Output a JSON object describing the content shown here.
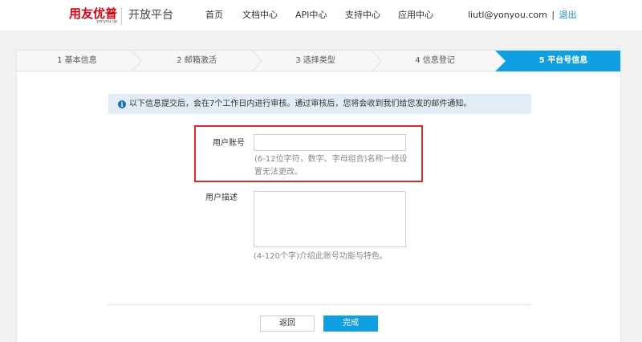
{
  "header": {
    "logo_text": "用友优普",
    "logo_sub": "yonyou up",
    "platform_title": "开放平台",
    "nav": [
      "首页",
      "文档中心",
      "API中心",
      "支持中心",
      "应用中心"
    ],
    "user_email": "liutl@yonyou.com",
    "separator": "|",
    "logout": "退出"
  },
  "steps": [
    "1 基本信息",
    "2 邮箱激活",
    "3 选择类型",
    "4 信息登记",
    "5 平台号信息"
  ],
  "active_step": 5,
  "colors": {
    "accent": "#10a0e2",
    "brand": "#d7000f",
    "highlight": "#d62b2b",
    "notice_bg": "#e1ecf6"
  },
  "notice": {
    "icon": "info-icon",
    "text": "以下信息提交后，会在7个工作日内进行审核。通过审核后，您将会收到我们给您发的邮件通知。"
  },
  "form": {
    "account_label": "用户账号",
    "account_value": "",
    "account_hint": "(6-12位字符，数字、字母组合)名称一经设置无法更改。",
    "desc_label": "用户描述",
    "desc_value": "",
    "desc_hint": "(4-120个字)介绍此账号功能与特色。"
  },
  "buttons": {
    "back": "返回",
    "done": "完成"
  }
}
